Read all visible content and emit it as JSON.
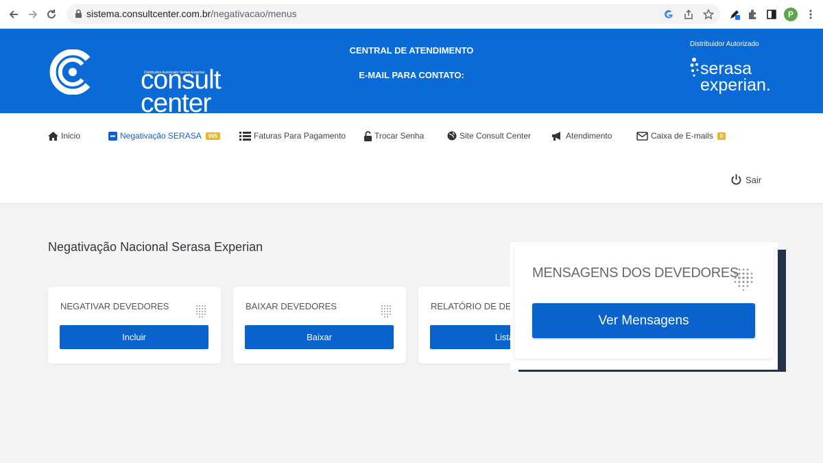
{
  "browser": {
    "url_host": "sistema.consultcenter.com.br",
    "url_path": "/negativacao/menus",
    "profile_initial": "P"
  },
  "header": {
    "logo_small": "Distribuidor Autorizado Serasa Experian",
    "logo_line1": "consult",
    "logo_line2": "center",
    "central_label": "CENTRAL DE ATENDIMENTO",
    "email_label": "E-MAIL PARA CONTATO:",
    "distributor_label": "Distribuidor Autorizado",
    "serasa_line1": "serasa",
    "serasa_line2": "experian."
  },
  "menu": {
    "items": [
      {
        "label": "Inicio",
        "icon": "home-icon"
      },
      {
        "label": "Negativação SERASA",
        "icon": "minus-square-icon",
        "badge": "995"
      },
      {
        "label": "Faturas Para Pagamento",
        "icon": "list-icon"
      },
      {
        "label": "Trocar Senha",
        "icon": "unlock-icon"
      },
      {
        "label": "Site Consult Center",
        "icon": "globe-icon"
      },
      {
        "label": "Atendimento",
        "icon": "megaphone-icon"
      },
      {
        "label": "Caixa de E-mails",
        "icon": "envelope-icon",
        "badge": "0"
      }
    ],
    "logout_label": "Sair"
  },
  "main": {
    "title": "Negativação Nacional Serasa Experian",
    "cards": [
      {
        "title": "NEGATIVAR DEVEDORES",
        "button": "Incluir"
      },
      {
        "title": "BAIXAR DEVEDORES",
        "button": "Baixar"
      },
      {
        "title": "RELATÓRIO DE DEVE",
        "button": "Lista"
      }
    ],
    "messages_card": {
      "title": "MENSAGENS DOS DEVEDORES",
      "button": "Ver Mensagens"
    }
  },
  "colors": {
    "header_blue": "#0a6ad6",
    "button_blue": "#0a63cc",
    "badge_yellow": "#f0b42b"
  }
}
